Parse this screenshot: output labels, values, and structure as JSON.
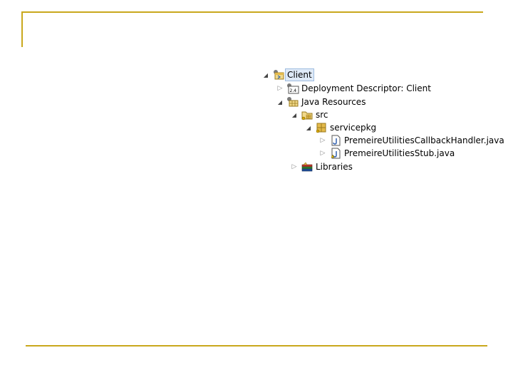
{
  "tree": {
    "nodes": [
      {
        "label": "Client",
        "icon": "project-icon",
        "expanded": true,
        "selected": true
      },
      {
        "label": "Deployment Descriptor: Client",
        "icon": "deployment-descriptor-icon",
        "expanded": false
      },
      {
        "label": "Java Resources",
        "icon": "java-resources-icon",
        "expanded": true
      },
      {
        "label": "src",
        "icon": "source-folder-icon",
        "expanded": true
      },
      {
        "label": "servicepkg",
        "icon": "package-icon",
        "expanded": true
      },
      {
        "label": "PremeireUtilitiesCallbackHandler.java",
        "icon": "java-file-icon",
        "expanded": false
      },
      {
        "label": "PremeireUtilitiesStub.java",
        "icon": "java-file-icon",
        "expanded": false
      },
      {
        "label": "Libraries",
        "icon": "libraries-icon",
        "expanded": false
      }
    ]
  },
  "twisty_glyphs": {
    "expanded": "◢",
    "collapsed": "▷"
  },
  "colors": {
    "accent_rule": "#c9a81d",
    "selection": "#dfeaf7"
  }
}
